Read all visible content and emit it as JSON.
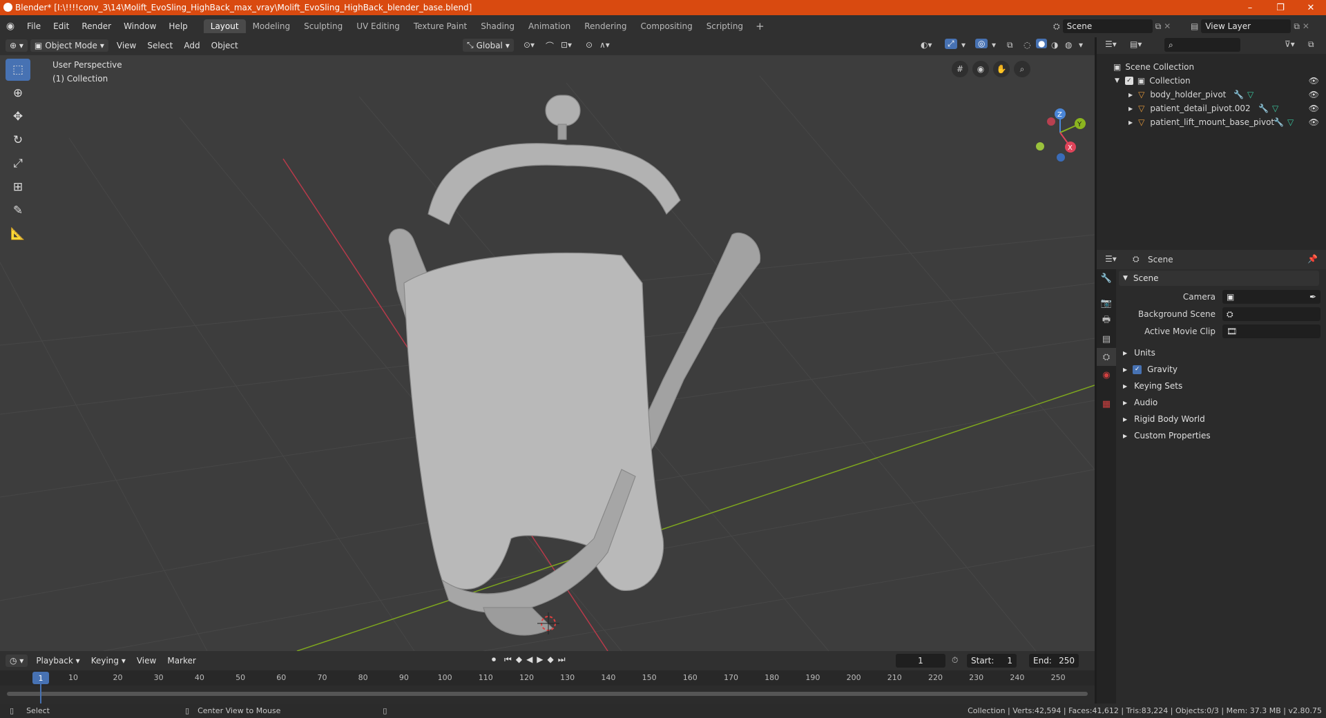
{
  "window": {
    "title": "Blender* [I:\\!!!!conv_3\\14\\Molift_EvoSling_HighBack_max_vray\\Molift_EvoSling_HighBack_blender_base.blend]",
    "controls": [
      "–",
      "❐",
      "✕"
    ]
  },
  "menu": [
    "File",
    "Edit",
    "Render",
    "Window",
    "Help"
  ],
  "workspaces": [
    "Layout",
    "Modeling",
    "Sculpting",
    "UV Editing",
    "Texture Paint",
    "Shading",
    "Animation",
    "Rendering",
    "Compositing",
    "Scripting"
  ],
  "active_workspace": "Layout",
  "scene_field": "Scene",
  "view_layer_field": "View Layer",
  "viewport_header": {
    "mode": "Object Mode",
    "menus": [
      "View",
      "Select",
      "Add",
      "Object"
    ],
    "orientation": "Global"
  },
  "viewport": {
    "overlay_line1": "User Perspective",
    "overlay_line2": "(1) Collection",
    "gizmo": {
      "z": "Z",
      "y": "Y",
      "x": "X"
    }
  },
  "outliner": {
    "root": "Scene Collection",
    "collection": "Collection",
    "items": [
      "body_holder_pivot",
      "patient_detail_pivot.002",
      "patient_lift_mount_base_pivot"
    ]
  },
  "properties": {
    "header": "Scene",
    "panel": "Scene",
    "fields": [
      {
        "label": "Camera",
        "value": ""
      },
      {
        "label": "Background Scene",
        "value": ""
      },
      {
        "label": "Active Movie Clip",
        "value": ""
      }
    ],
    "subpanels": [
      "Units",
      "Gravity",
      "Keying Sets",
      "Audio",
      "Rigid Body World",
      "Custom Properties"
    ],
    "gravity_checked": true
  },
  "timeline": {
    "menus": [
      "Playback",
      "Keying",
      "View",
      "Marker"
    ],
    "current_frame": "1",
    "start_label": "Start:",
    "start": "1",
    "end_label": "End:",
    "end": "250",
    "ticks": [
      "1",
      "10",
      "20",
      "30",
      "40",
      "50",
      "60",
      "70",
      "80",
      "90",
      "100",
      "110",
      "120",
      "130",
      "140",
      "150",
      "160",
      "170",
      "180",
      "190",
      "200",
      "210",
      "220",
      "230",
      "240",
      "250"
    ]
  },
  "statusbar": {
    "left": "Select",
    "middle": "Center View to Mouse",
    "right": "Collection | Verts:42,594 | Faces:41,612 | Tris:83,224 | Objects:0/3 | Mem: 37.3 MB | v2.80.75"
  },
  "colors": {
    "titlebar": "#d94a10",
    "accent": "#4772b3",
    "x_axis": "#e0445a",
    "y_axis": "#8bb51f",
    "z_axis": "#4a86d8"
  }
}
